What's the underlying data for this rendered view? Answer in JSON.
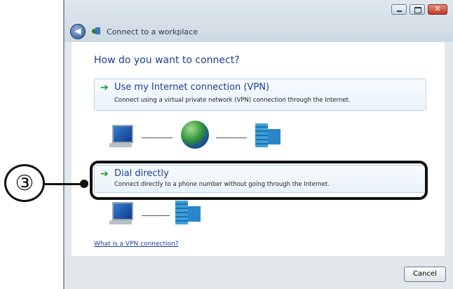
{
  "window": {
    "title": "Connect to a workplace",
    "heading": "How do you want to connect?"
  },
  "options": [
    {
      "title": "Use my Internet connection (VPN)",
      "description": "Connect using a virtual private network (VPN) connection through the Internet."
    },
    {
      "title": "Dial directly",
      "description": "Connect directly to a phone number without going through the Internet."
    }
  ],
  "help_link": "What is a VPN connection?",
  "buttons": {
    "cancel": "Cancel"
  },
  "callout": {
    "number": "③"
  },
  "icons": {
    "back": "back-arrow-icon",
    "wizard": "network-wizard-icon",
    "option_arrow": "green-arrow-icon",
    "computer": "computer-icon",
    "internet": "globe-icon",
    "workplace": "office-building-icon"
  },
  "colors": {
    "link": "#1c3f94",
    "arrow": "#1c9a2c"
  }
}
